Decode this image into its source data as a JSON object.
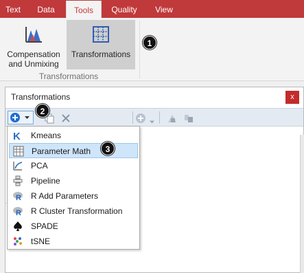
{
  "ribbon": {
    "tabs": [
      {
        "label": "Text"
      },
      {
        "label": "Data"
      },
      {
        "label": "Tools",
        "active": true
      },
      {
        "label": "Quality"
      },
      {
        "label": "View"
      }
    ],
    "buttons": {
      "compensation": {
        "line1": "Compensation",
        "line2": "and Unmixing"
      },
      "transformations": {
        "label": "Transformations"
      }
    },
    "group_label": "Transformations"
  },
  "callouts": [
    "1",
    "2",
    "3"
  ],
  "panel": {
    "title": "Transformations",
    "close_glyph": "x"
  },
  "menu": {
    "items": [
      {
        "label": "Kmeans",
        "icon": "kmeans-icon"
      },
      {
        "label": "Parameter Math",
        "icon": "parameter-math-icon",
        "highlighted": true
      },
      {
        "label": "PCA",
        "icon": "pca-icon"
      },
      {
        "label": "Pipeline",
        "icon": "pipeline-icon"
      },
      {
        "label": "R Add Parameters",
        "icon": "r-icon"
      },
      {
        "label": "R Cluster Transformation",
        "icon": "r-icon"
      },
      {
        "label": "SPADE",
        "icon": "spade-icon"
      },
      {
        "label": "tSNE",
        "icon": "tsne-icon"
      }
    ]
  },
  "colors": {
    "ribbon_accent": "#c0393b",
    "toolbar_bg": "#e4eaf2",
    "menu_highlight": "#cfe5f9",
    "close_button": "#c42b2b"
  }
}
